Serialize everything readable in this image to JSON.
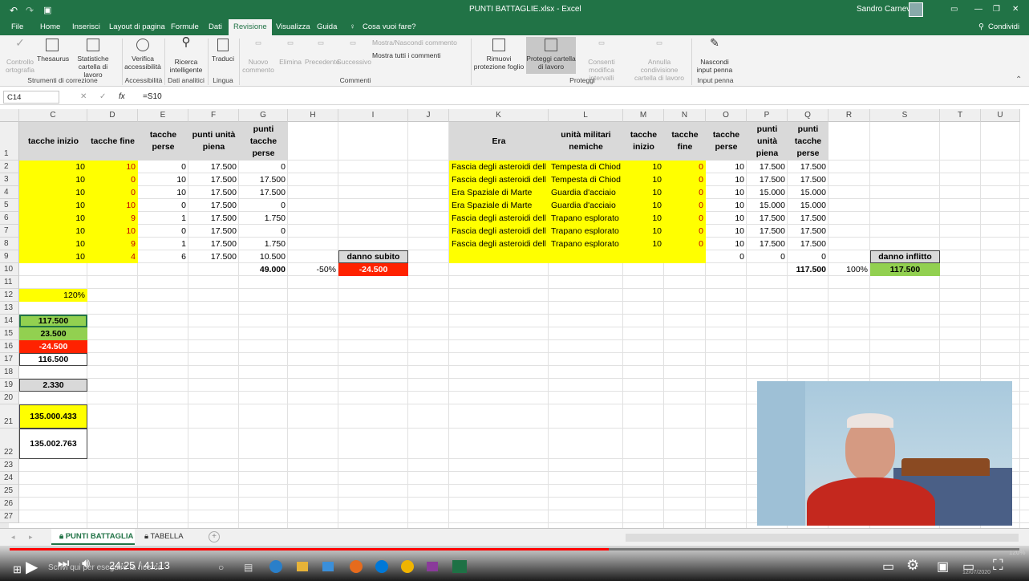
{
  "window": {
    "title": "PUNTI BATTAGLIE.xlsx - Excel",
    "user": "Sandro Carnevali"
  },
  "menu": [
    "File",
    "Home",
    "Inserisci",
    "Layout di pagina",
    "Formule",
    "Dati",
    "Revisione",
    "Visualizza",
    "Guida",
    "Cosa vuoi fare?"
  ],
  "share_label": "Condividi",
  "ribbon": {
    "b": [
      "Controllo ortografia",
      "Thesaurus",
      "Statistiche cartella di lavoro",
      "Verifica accessibilità",
      "Ricerca intelligente",
      "Traduci",
      "Nuovo commento",
      "Elimina",
      "Precedente",
      "Successivo",
      "Mostra/Nascondi commento",
      "Mostra tutti i commenti",
      "Rimuovi protezione foglio",
      "Proteggi cartella di lavoro",
      "Consenti modifica intervalli",
      "Annulla condivisione cartella di lavoro",
      "Nascondi input penna"
    ],
    "groups": [
      "Strumenti di correzione",
      "Accessibilità",
      "Dati analitici",
      "Lingua",
      "Commenti",
      "Proteggi",
      "Input penna"
    ]
  },
  "formula": {
    "cell": "C14",
    "fx": "fx",
    "content": "=S10"
  },
  "cols": [
    "C",
    "D",
    "E",
    "F",
    "G",
    "H",
    "I",
    "J",
    "K",
    "L",
    "M",
    "N",
    "O",
    "P",
    "Q",
    "R",
    "S",
    "T",
    "U"
  ],
  "rows": [
    "1",
    "2",
    "3",
    "4",
    "5",
    "6",
    "7",
    "8",
    "9",
    "10",
    "11",
    "12",
    "13",
    "14",
    "15",
    "16",
    "17",
    "18",
    "19",
    "20",
    "21",
    "22",
    "23",
    "24",
    "25",
    "26",
    "27"
  ],
  "headers_left": [
    "tacche inizio",
    "tacche fine",
    "tacche perse",
    "punti unità piena",
    "punti tacche perse"
  ],
  "left_rows": [
    [
      "10",
      "10",
      "0",
      "17.500",
      "0"
    ],
    [
      "10",
      "0",
      "10",
      "17.500",
      "17.500"
    ],
    [
      "10",
      "0",
      "10",
      "17.500",
      "17.500"
    ],
    [
      "10",
      "10",
      "0",
      "17.500",
      "0"
    ],
    [
      "10",
      "9",
      "1",
      "17.500",
      "1.750"
    ],
    [
      "10",
      "10",
      "0",
      "17.500",
      "0"
    ],
    [
      "10",
      "9",
      "1",
      "17.500",
      "1.750"
    ],
    [
      "10",
      "4",
      "6",
      "17.500",
      "10.500"
    ]
  ],
  "danno_subito": {
    "label": "danno subito",
    "total": "49.000",
    "pct": "-50%",
    "value": "-24.500"
  },
  "headers_right": [
    "Era",
    "unità militari nemiche",
    "tacche inizio",
    "tacche fine",
    "tacche perse",
    "punti unità piena",
    "punti tacche perse"
  ],
  "right_rows": [
    [
      "Fascia degli asteroidi dell",
      "Tempesta di Chiod",
      "10",
      "0",
      "10",
      "17.500",
      "17.500"
    ],
    [
      "Fascia degli asteroidi dell",
      "Tempesta di Chiod",
      "10",
      "0",
      "10",
      "17.500",
      "17.500"
    ],
    [
      "Era Spaziale di Marte",
      "Guardia d'acciaio",
      "10",
      "0",
      "10",
      "15.000",
      "15.000"
    ],
    [
      "Era Spaziale di Marte",
      "Guardia d'acciaio",
      "10",
      "0",
      "10",
      "15.000",
      "15.000"
    ],
    [
      "Fascia degli asteroidi dell",
      "Trapano esplorato",
      "10",
      "0",
      "10",
      "17.500",
      "17.500"
    ],
    [
      "Fascia degli asteroidi dell",
      "Trapano esplorato",
      "10",
      "0",
      "10",
      "17.500",
      "17.500"
    ],
    [
      "Fascia degli asteroidi dell",
      "Trapano esplorato",
      "10",
      "0",
      "10",
      "17.500",
      "17.500"
    ],
    [
      "",
      "",
      "",
      "",
      "0",
      "0",
      "0"
    ]
  ],
  "danno_inflitto": {
    "label": "danno inflitto",
    "total": "117.500",
    "pct": "100%",
    "value": "117.500"
  },
  "side": {
    "pct": "120%",
    "r14": "117.500",
    "r15": "23.500",
    "r16": "-24.500",
    "r17": "116.500",
    "r19": "2.330",
    "r21": "135.000.433",
    "r22": "135.002.763"
  },
  "sheets": [
    "PUNTI BATTAGLIA",
    "TABELLA"
  ],
  "zoom": "120%",
  "video": {
    "time": "24:25 / 41:13",
    "progress_pct": 59.3
  },
  "taskbar": {
    "search": "Scrivi qui per eseguire la ricerca",
    "date": "12/07/2020"
  },
  "colors": {
    "excel_green": "#217346",
    "yellow": "#ffff00",
    "green": "#92d050",
    "red": "#ff2200",
    "gray": "#d9d9d9"
  }
}
